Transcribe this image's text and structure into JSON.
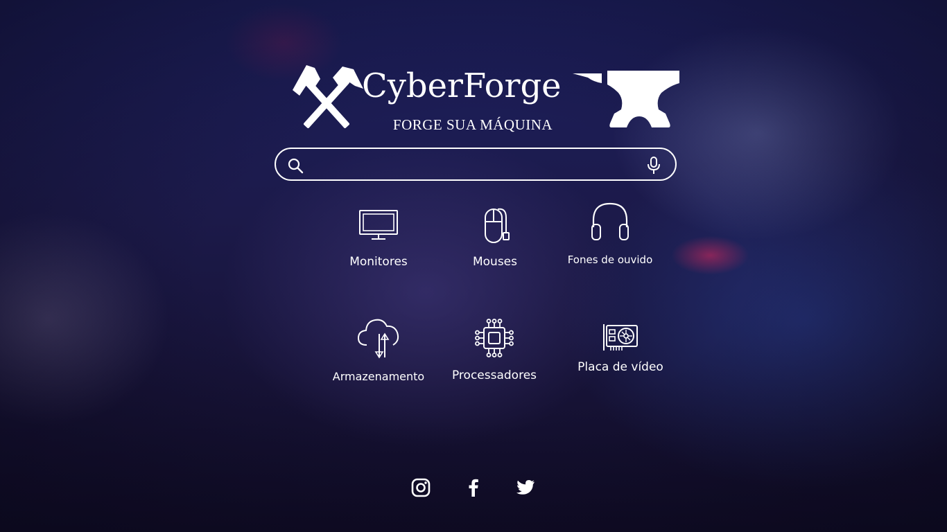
{
  "brand": {
    "name": "CyberForge",
    "tagline": "FORGE SUA MÁQUINA"
  },
  "search": {
    "placeholder": "",
    "value": ""
  },
  "categories": [
    {
      "label": "Monitores",
      "icon": "monitor-icon"
    },
    {
      "label": "Mouses",
      "icon": "mouse-icon"
    },
    {
      "label": "Fones de ouvido",
      "icon": "headphones-icon"
    },
    {
      "label": "Armazenamento",
      "icon": "cloud-storage-icon"
    },
    {
      "label": "Processadores",
      "icon": "processor-icon"
    },
    {
      "label": "Placa de vídeo",
      "icon": "graphics-card-icon"
    }
  ],
  "social": [
    {
      "icon": "instagram-icon"
    },
    {
      "icon": "facebook-icon"
    },
    {
      "icon": "twitter-icon"
    }
  ],
  "colors": {
    "text": "#ffffff",
    "background": "#1c1a4a",
    "accent_glow": "#dc285a"
  }
}
